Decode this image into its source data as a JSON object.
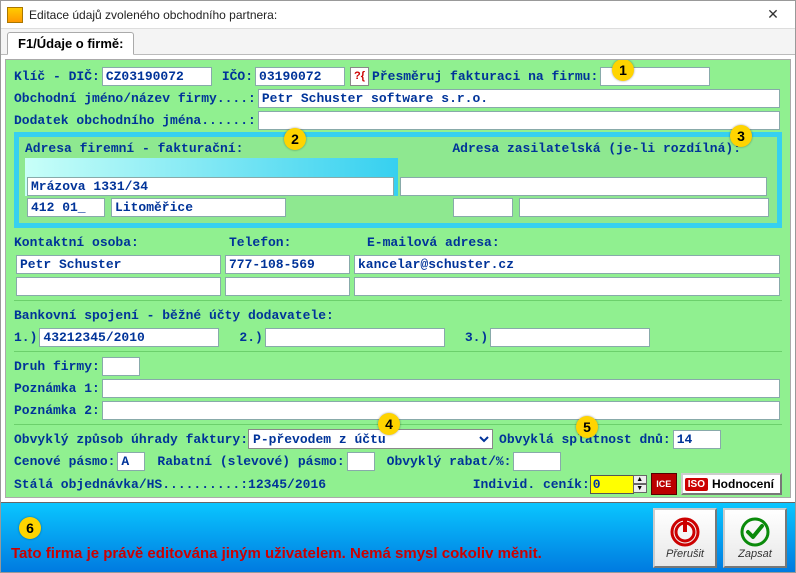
{
  "window": {
    "title": "Editace údajů zvoleného obchodního partnera:"
  },
  "tab": {
    "label": "F1/Údaje o firmě:"
  },
  "top": {
    "klic_dic_label": "Klíč - DIČ:",
    "klic_dic": "CZ03190072",
    "ico_label": "IČO:",
    "ico": "03190072",
    "lookup_btn": "?{",
    "presmeruj_label": "Přesměruj fakturaci na firmu:",
    "presmeruj_value": "",
    "jmeno_label": "Obchodní jméno/název firmy....:",
    "jmeno": "Petr Schuster software s.r.o.",
    "dodatek_label": "Dodatek obchodního jména......:",
    "dodatek": ""
  },
  "addr": {
    "firemni_label": "Adresa firemní - fakturační:",
    "zasilatel_label": "Adresa zasilatelská (je-li rozdílná):",
    "street": "Mrázova 1331/34",
    "zip": "412 01_",
    "city": "Litoměřice",
    "right_street": "",
    "right_zip": "",
    "right_city": ""
  },
  "contact": {
    "osoba_label": "Kontaktní osoba:",
    "osoba": "Petr Schuster",
    "tel_label": "Telefon:",
    "tel": "777-108-569",
    "mail_label": "E-mailová adresa:",
    "mail": "kancelar@schuster.cz",
    "line2a": "",
    "line2b": "",
    "line2c": ""
  },
  "bank": {
    "header": "Bankovní spojení - běžné účty dodavatele:",
    "l1": "1.)",
    "v1": "43212345/2010",
    "l2": "2.)",
    "v2": "",
    "l3": "3.)",
    "v3": ""
  },
  "misc": {
    "druh_label": "Druh firmy:",
    "druh": "",
    "pozn1_label": "Poznámka 1:",
    "pozn1": "",
    "pozn2_label": "Poznámka 2:",
    "pozn2": ""
  },
  "pay": {
    "method_label": "Obvyklý způsob úhrady faktury:",
    "method_value": "P-převodem z účtu",
    "due_label": "Obvyklá splatnost dnů:",
    "due": "14",
    "price_band_label": "Cenové pásmo:",
    "price_band": "A",
    "rabat_band_label": "Rabatní (slevové) pásmo:",
    "rabat_band": "",
    "rabat_pct_label": "Obvyklý rabat/%:",
    "rabat_pct": "",
    "order_label": "Stálá objednávka/HS..........:",
    "order": "12345/2016",
    "indiv_label": "Individ. ceník:",
    "indiv": "0",
    "red_btn_label": "ICE",
    "iso_badge": "ISO",
    "iso_label": "Hodnocení"
  },
  "footer": {
    "msg": "Tato firma je právě editována jiným uživatelem. Nemá smysl cokoliv měnit.",
    "cancel": "Přerušit",
    "ok": "Zapsat"
  },
  "markers": {
    "m1": "1",
    "m2": "2",
    "m3": "3",
    "m4": "4",
    "m5": "5",
    "m6": "6"
  }
}
